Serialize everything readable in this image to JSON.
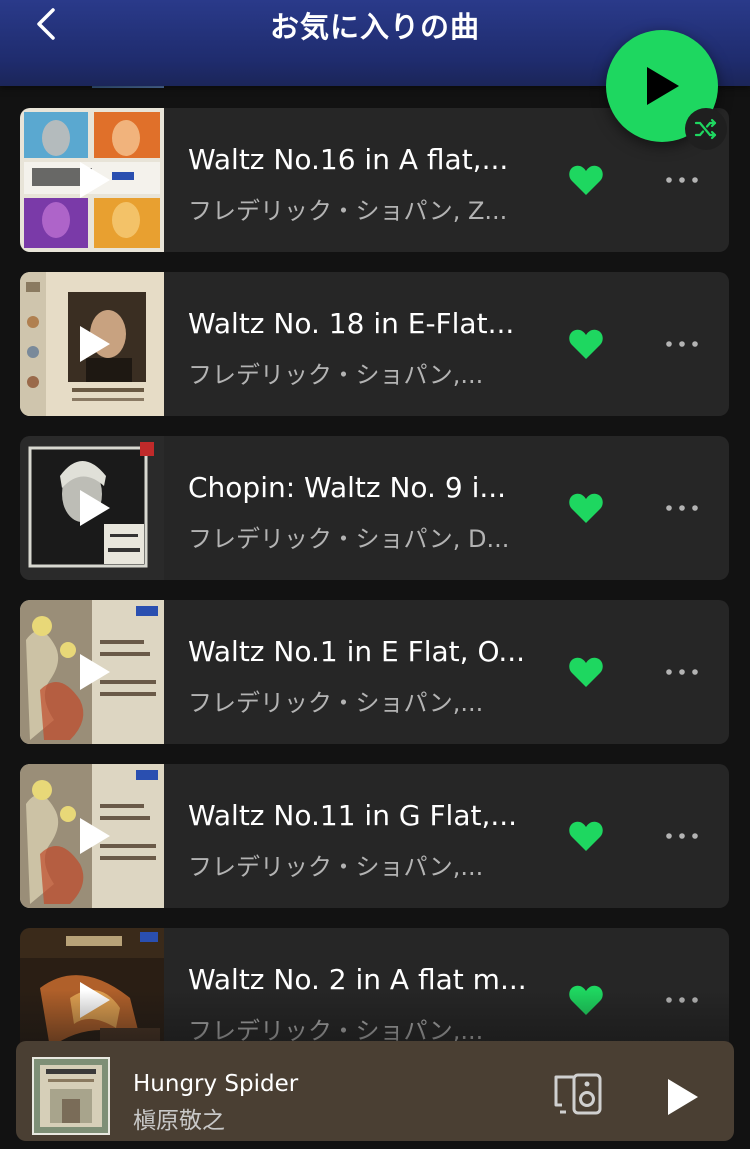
{
  "header": {
    "title": "お気に入りの曲",
    "back_icon": "chevron-left-icon"
  },
  "actions": {
    "play_icon": "play-icon",
    "shuffle_icon": "shuffle-icon",
    "accent_color": "#1ed760"
  },
  "tracks": [
    {
      "title": "Waltz No.16 in A flat,...",
      "artist": "フレデリック・ショパン, Z...",
      "liked": true
    },
    {
      "title": "Waltz No. 18 in E-Flat...",
      "artist": "フレデリック・ショパン,...",
      "liked": true
    },
    {
      "title": "Chopin: Waltz No. 9 i...",
      "artist": "フレデリック・ショパン, D...",
      "liked": true
    },
    {
      "title": "Waltz No.1 in E Flat, O...",
      "artist": "フレデリック・ショパン,...",
      "liked": true
    },
    {
      "title": "Waltz No.11 in G Flat,...",
      "artist": "フレデリック・ショパン,...",
      "liked": true
    },
    {
      "title": "Waltz No. 2 in A flat m...",
      "artist": "フレデリック・ショパン,...",
      "liked": true
    }
  ],
  "now_playing": {
    "title": "Hungry Spider",
    "artist": "槇原敬之",
    "device_icon": "speaker-device-icon",
    "play_icon": "play-icon"
  }
}
